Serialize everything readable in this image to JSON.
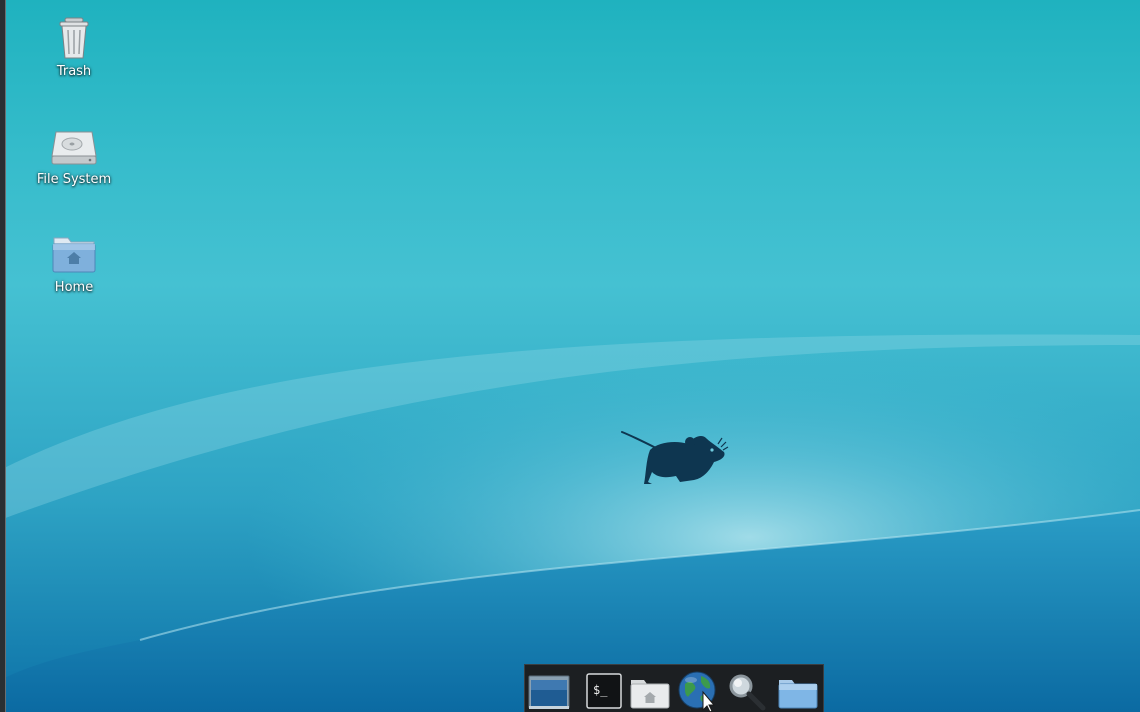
{
  "desktop": {
    "icons": [
      {
        "label": "Trash",
        "icon": "trash-icon"
      },
      {
        "label": "File System",
        "icon": "hard-drive-icon"
      },
      {
        "label": "Home",
        "icon": "home-folder-icon"
      }
    ],
    "wallpaper": {
      "logo": "xfce-mouse-logo"
    }
  },
  "dock": {
    "items": [
      {
        "icon": "show-desktop-icon"
      },
      {
        "icon": "terminal-icon",
        "glyph": "$_"
      },
      {
        "icon": "home-folder-icon"
      },
      {
        "icon": "web-browser-globe-icon"
      },
      {
        "icon": "search-magnifier-icon"
      },
      {
        "icon": "folder-icon"
      }
    ]
  },
  "colors": {
    "wallpaper_top": "#1fb2bf",
    "wallpaper_bottom": "#0d72a8",
    "panel_bg": "#1c1f22",
    "label_text": "#ffffff"
  }
}
